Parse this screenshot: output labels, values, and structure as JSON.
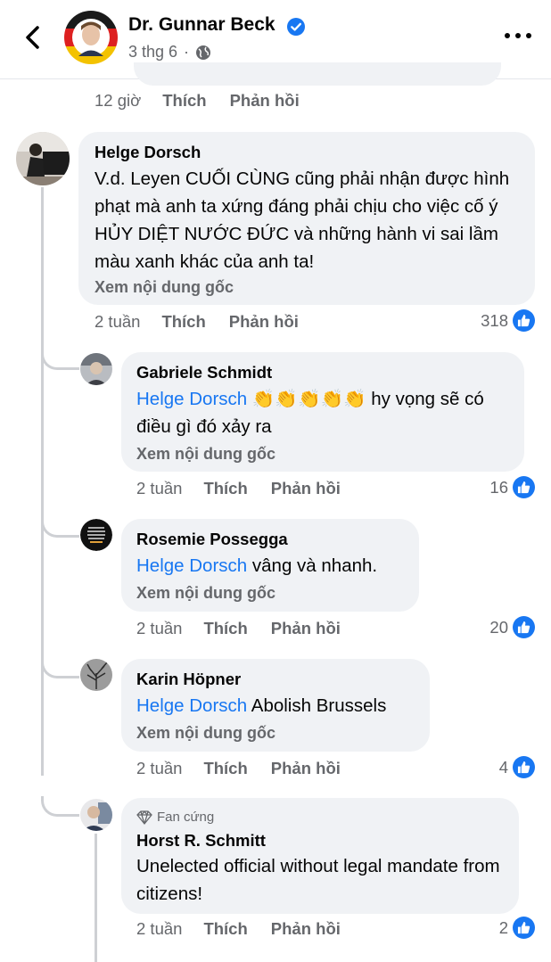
{
  "header": {
    "page_name": "Dr. Gunnar Beck",
    "date": "3 thg 6",
    "separator": "·"
  },
  "colors": {
    "accent": "#1877f2",
    "bubble": "#f0f2f5",
    "secondary_text": "#65676b"
  },
  "prev_comment": {
    "time": "12 giờ",
    "like_label": "Thích",
    "reply_label": "Phản hồi"
  },
  "comments": [
    {
      "author": "Helge Dorsch",
      "text": "V.d. Leyen CUỐI CÙNG cũng phải nhận được hình phạt mà anh ta xứng đáng phải chịu cho việc cố ý HỦY DIỆT NƯỚC ĐỨC và những hành vi sai lầm màu xanh khác của anh ta!",
      "see_original": "Xem nội dung gốc",
      "time": "2 tuần",
      "like_label": "Thích",
      "reply_label": "Phản hồi",
      "reactions": "318"
    }
  ],
  "replies": [
    {
      "author": "Gabriele Schmidt",
      "mention": "Helge Dorsch",
      "emoji": "👏👏👏👏👏",
      "text": "hy vọng sẽ có điều gì đó xảy ra",
      "see_original": "Xem nội dung gốc",
      "time": "2 tuần",
      "like_label": "Thích",
      "reply_label": "Phản hồi",
      "reactions": "16"
    },
    {
      "author": "Rosemie Possegga",
      "mention": "Helge Dorsch",
      "text": "vâng và nhanh.",
      "see_original": "Xem nội dung gốc",
      "time": "2 tuần",
      "like_label": "Thích",
      "reply_label": "Phản hồi",
      "reactions": "20"
    },
    {
      "author": "Karin Höpner",
      "mention": "Helge Dorsch",
      "text": "Abolish Brussels",
      "see_original": "Xem nội dung gốc",
      "time": "2 tuần",
      "like_label": "Thích",
      "reply_label": "Phản hồi",
      "reactions": "4"
    },
    {
      "badge": "Fan cứng",
      "author": "Horst R. Schmitt",
      "text": "Unelected official without legal mandate from citizens!",
      "time": "2 tuần",
      "like_label": "Thích",
      "reply_label": "Phản hồi",
      "reactions": "2"
    }
  ],
  "icons": {
    "back": "chevron-left-icon",
    "verified": "verified-badge-icon",
    "globe": "globe-icon",
    "more": "more-icon",
    "like": "like-thumb-icon",
    "badge": "diamond-icon"
  }
}
